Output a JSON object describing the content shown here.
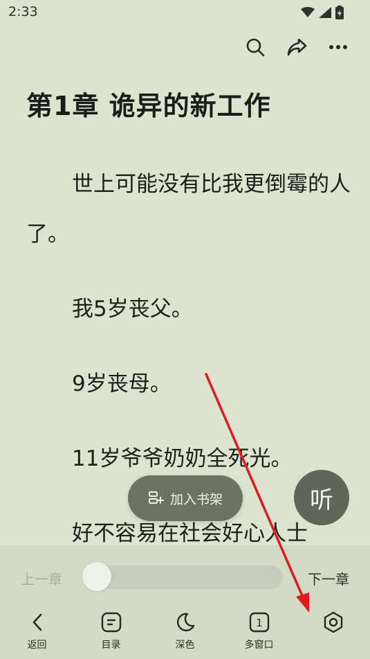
{
  "status_bar": {
    "time": "2:33"
  },
  "chapter": {
    "title": "第1章 诡异的新工作",
    "paragraphs": [
      "世上可能没有比我更倒霉的人了。",
      "我5岁丧父。",
      "9岁丧母。",
      "11岁爷爷奶奶全死光。",
      "好不容易在社会好心人士"
    ]
  },
  "floating": {
    "add_to_shelf": "加入书架",
    "listen": "听"
  },
  "progress_bar": {
    "prev": "上一章",
    "next": "下一章",
    "progress_fraction": 0.0
  },
  "toolbar": {
    "back": "返回",
    "toc": "目录",
    "dark": "深色",
    "multi_window": "多窗口"
  },
  "icons": [
    "search-icon",
    "share-icon",
    "more-icon",
    "back-icon",
    "toc-icon",
    "moon-icon",
    "multi-window-icon",
    "settings-icon",
    "wifi-icon",
    "signal-icon",
    "battery-icon"
  ],
  "annotation_color": "#e11b1b"
}
